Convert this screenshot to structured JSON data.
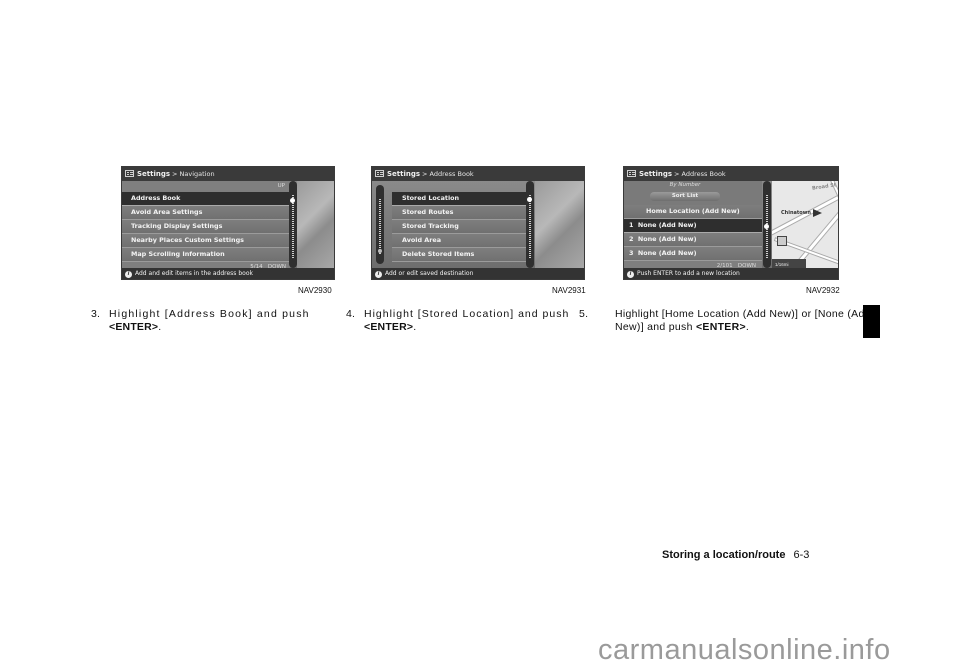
{
  "panels": [
    {
      "title": "Settings",
      "breadcrumb": "> Navigation",
      "top_label": "UP",
      "items": [
        "Address Book",
        "Avoid Area Settings",
        "Tracking Display Settings",
        "Nearby Places Custom Settings",
        "Map Scrolling Information"
      ],
      "selected_index": 0,
      "page_indicator": "5/14",
      "bottom_label": "DOWN",
      "status": "Add and edit items in the address book",
      "code": "NAV2930",
      "step_number": "3.",
      "step_text": "Highlight [Address Book] and push",
      "step_key": "<ENTER>",
      "step_end": "."
    },
    {
      "title": "Settings",
      "breadcrumb": "> Address Book",
      "items": [
        "Stored Location",
        "Stored Routes",
        "Stored Tracking",
        "Avoid Area",
        "Delete Stored Items"
      ],
      "selected_index": 0,
      "status": "Add or edit saved destination",
      "code": "NAV2931",
      "step_number": "4.",
      "step_text": "Highlight [Stored Location] and push",
      "step_key": "<ENTER>",
      "step_end": "."
    },
    {
      "title": "Settings",
      "breadcrumb": "> Address Book",
      "sort_caption": "By Number",
      "sort_button": "Sort List",
      "items": [
        "Home Location (Add New)",
        "1  None (Add New)",
        "2  None (Add New)",
        "3  None (Add New)"
      ],
      "selected_index": 1,
      "page_indicator": "2/101",
      "bottom_label": "DOWN",
      "map_labels": {
        "street": "Broad St",
        "area": "Chinatown",
        "scale": "1/16mi"
      },
      "status": "Push ENTER to add a new location",
      "code": "NAV2932",
      "step_number": "5.",
      "step_text": "Highlight [Home Location (Add New)] or [None (Add New)] and push",
      "step_key": "<ENTER>",
      "step_end": "."
    }
  ],
  "footer": {
    "section": "Storing a location/route",
    "page": "6-3"
  },
  "watermark": "carmanualsonline.info"
}
